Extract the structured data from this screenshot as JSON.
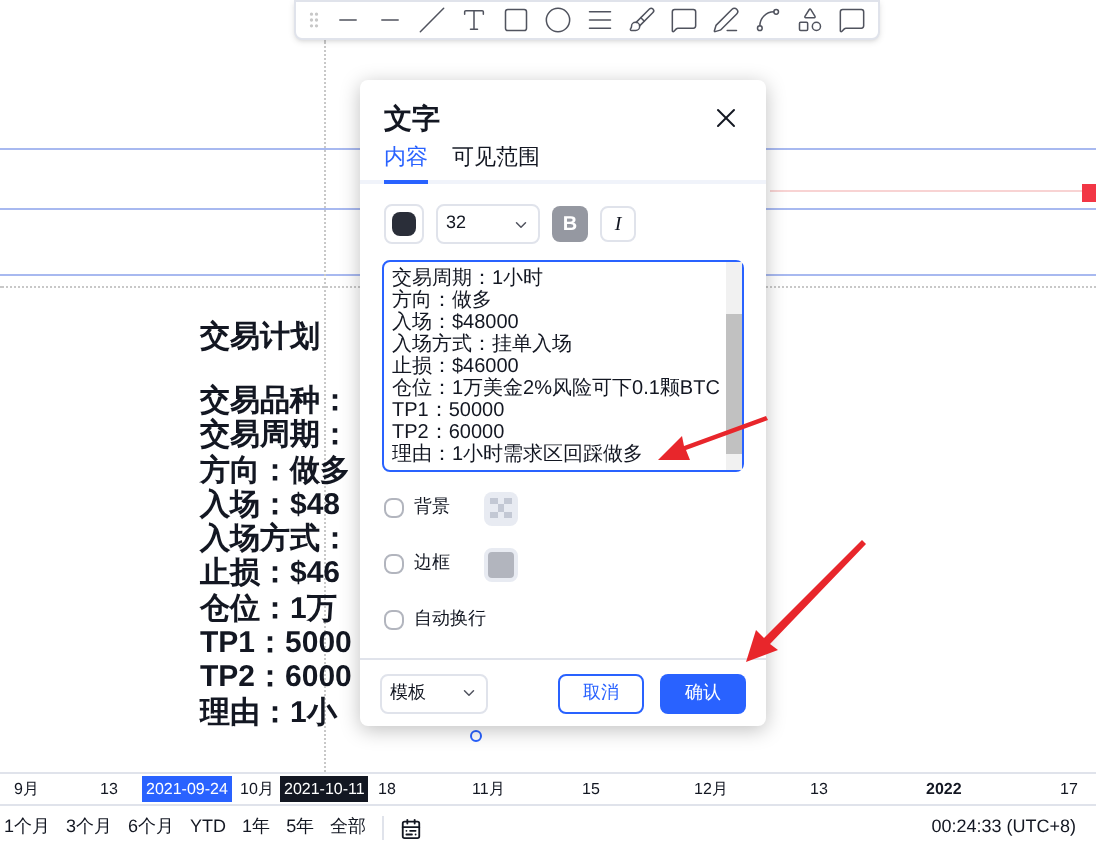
{
  "chart": {
    "title": "交易计划",
    "lines": [
      "交易品种：",
      "交易周期：",
      "方向：做多",
      "入场：$48",
      "入场方式：",
      "止损：$46",
      "仓位：1万",
      "TP1：5000",
      "TP2：6000",
      "理由：1小"
    ]
  },
  "dialog": {
    "title": "文字",
    "tabs": [
      {
        "label": "内容",
        "selected": true
      },
      {
        "label": "可见范围",
        "selected": false
      }
    ],
    "font_size": "32",
    "bold": {
      "label": "B",
      "selected": true
    },
    "italic": {
      "label": "I",
      "selected": false
    },
    "text_lines": [
      "交易周期：1小时",
      "方向：做多",
      "入场：$48000",
      "入场方式：挂单入场",
      "止损：$46000",
      "仓位：1万美金2%风险可下0.1颗BTC",
      "TP1：50000",
      "TP2：60000",
      "理由：1小时需求区回踩做多"
    ],
    "options": [
      {
        "label": "背景",
        "checked": false,
        "kind": "pattern"
      },
      {
        "label": "边框",
        "checked": false,
        "kind": "solid"
      },
      {
        "label": "自动换行",
        "checked": false,
        "kind": "plain"
      }
    ],
    "template": "模板",
    "cancel": "取消",
    "confirm": "确认"
  },
  "time_axis": [
    {
      "label": "9月",
      "kind": "plain"
    },
    {
      "label": "13",
      "kind": "plain"
    },
    {
      "label": "2021-09-24",
      "kind": "selection"
    },
    {
      "label": "10月",
      "kind": "plain"
    },
    {
      "label": "2021-10-11",
      "kind": "crosshair"
    },
    {
      "label": "18",
      "kind": "plain"
    },
    {
      "label": "11月",
      "kind": "plain"
    },
    {
      "label": "15",
      "kind": "plain"
    },
    {
      "label": "12月",
      "kind": "plain"
    },
    {
      "label": "13",
      "kind": "plain"
    },
    {
      "label": "2022",
      "kind": "year"
    },
    {
      "label": "17",
      "kind": "plain"
    }
  ],
  "ranges": [
    "1个月",
    "3个月",
    "6个月",
    "YTD",
    "1年",
    "5年",
    "全部"
  ],
  "clock": "00:24:33 (UTC+8)"
}
